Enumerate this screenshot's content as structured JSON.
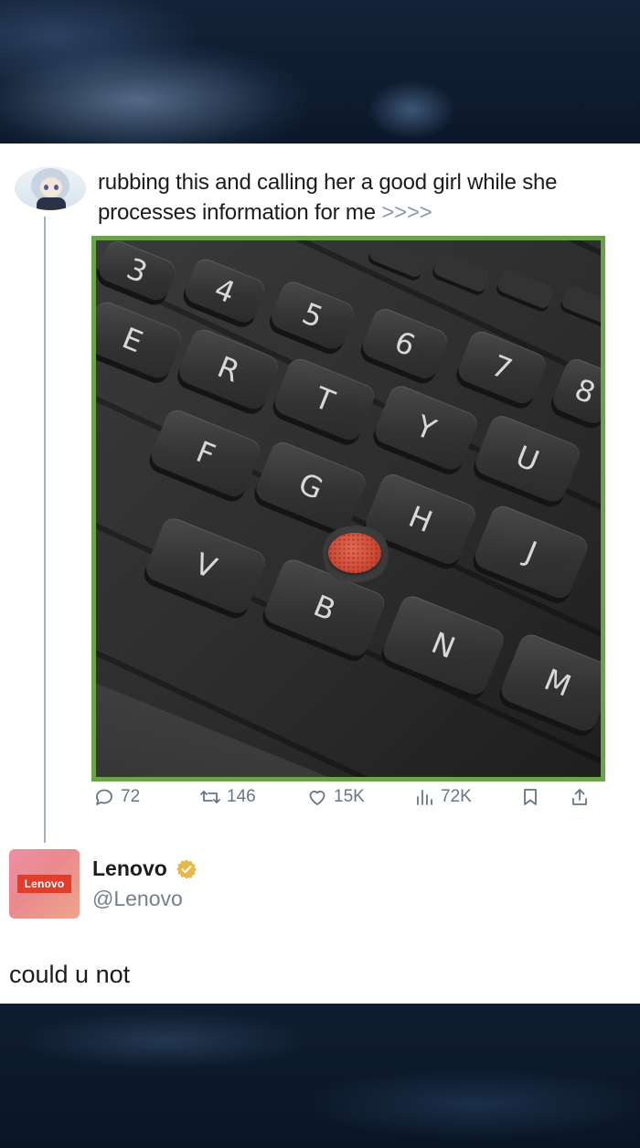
{
  "tweet": {
    "text": "rubbing this and calling her a good girl while she processes information for me",
    "arrows": ">>>>",
    "photo_keys": [
      "3",
      "4",
      "5",
      "6",
      "7",
      "8",
      "E",
      "R",
      "T",
      "Y",
      "U",
      "F",
      "G",
      "H",
      "J",
      "V",
      "B",
      "N",
      "M"
    ],
    "actions": {
      "replies": "72",
      "retweets": "146",
      "likes": "15K",
      "views": "72K"
    }
  },
  "reply": {
    "avatar_logo": "Lenovo",
    "name": "Lenovo",
    "handle": "@Lenovo",
    "text": "could u not"
  },
  "colors": {
    "photo_border": "#6ba34a",
    "verified_badge": "#e8b84a",
    "lenovo_red": "#e23c2b",
    "muted_text": "#687684"
  },
  "icons": [
    "reply-icon",
    "retweet-icon",
    "like-icon",
    "views-icon",
    "bookmark-icon",
    "share-icon",
    "verified-icon"
  ]
}
